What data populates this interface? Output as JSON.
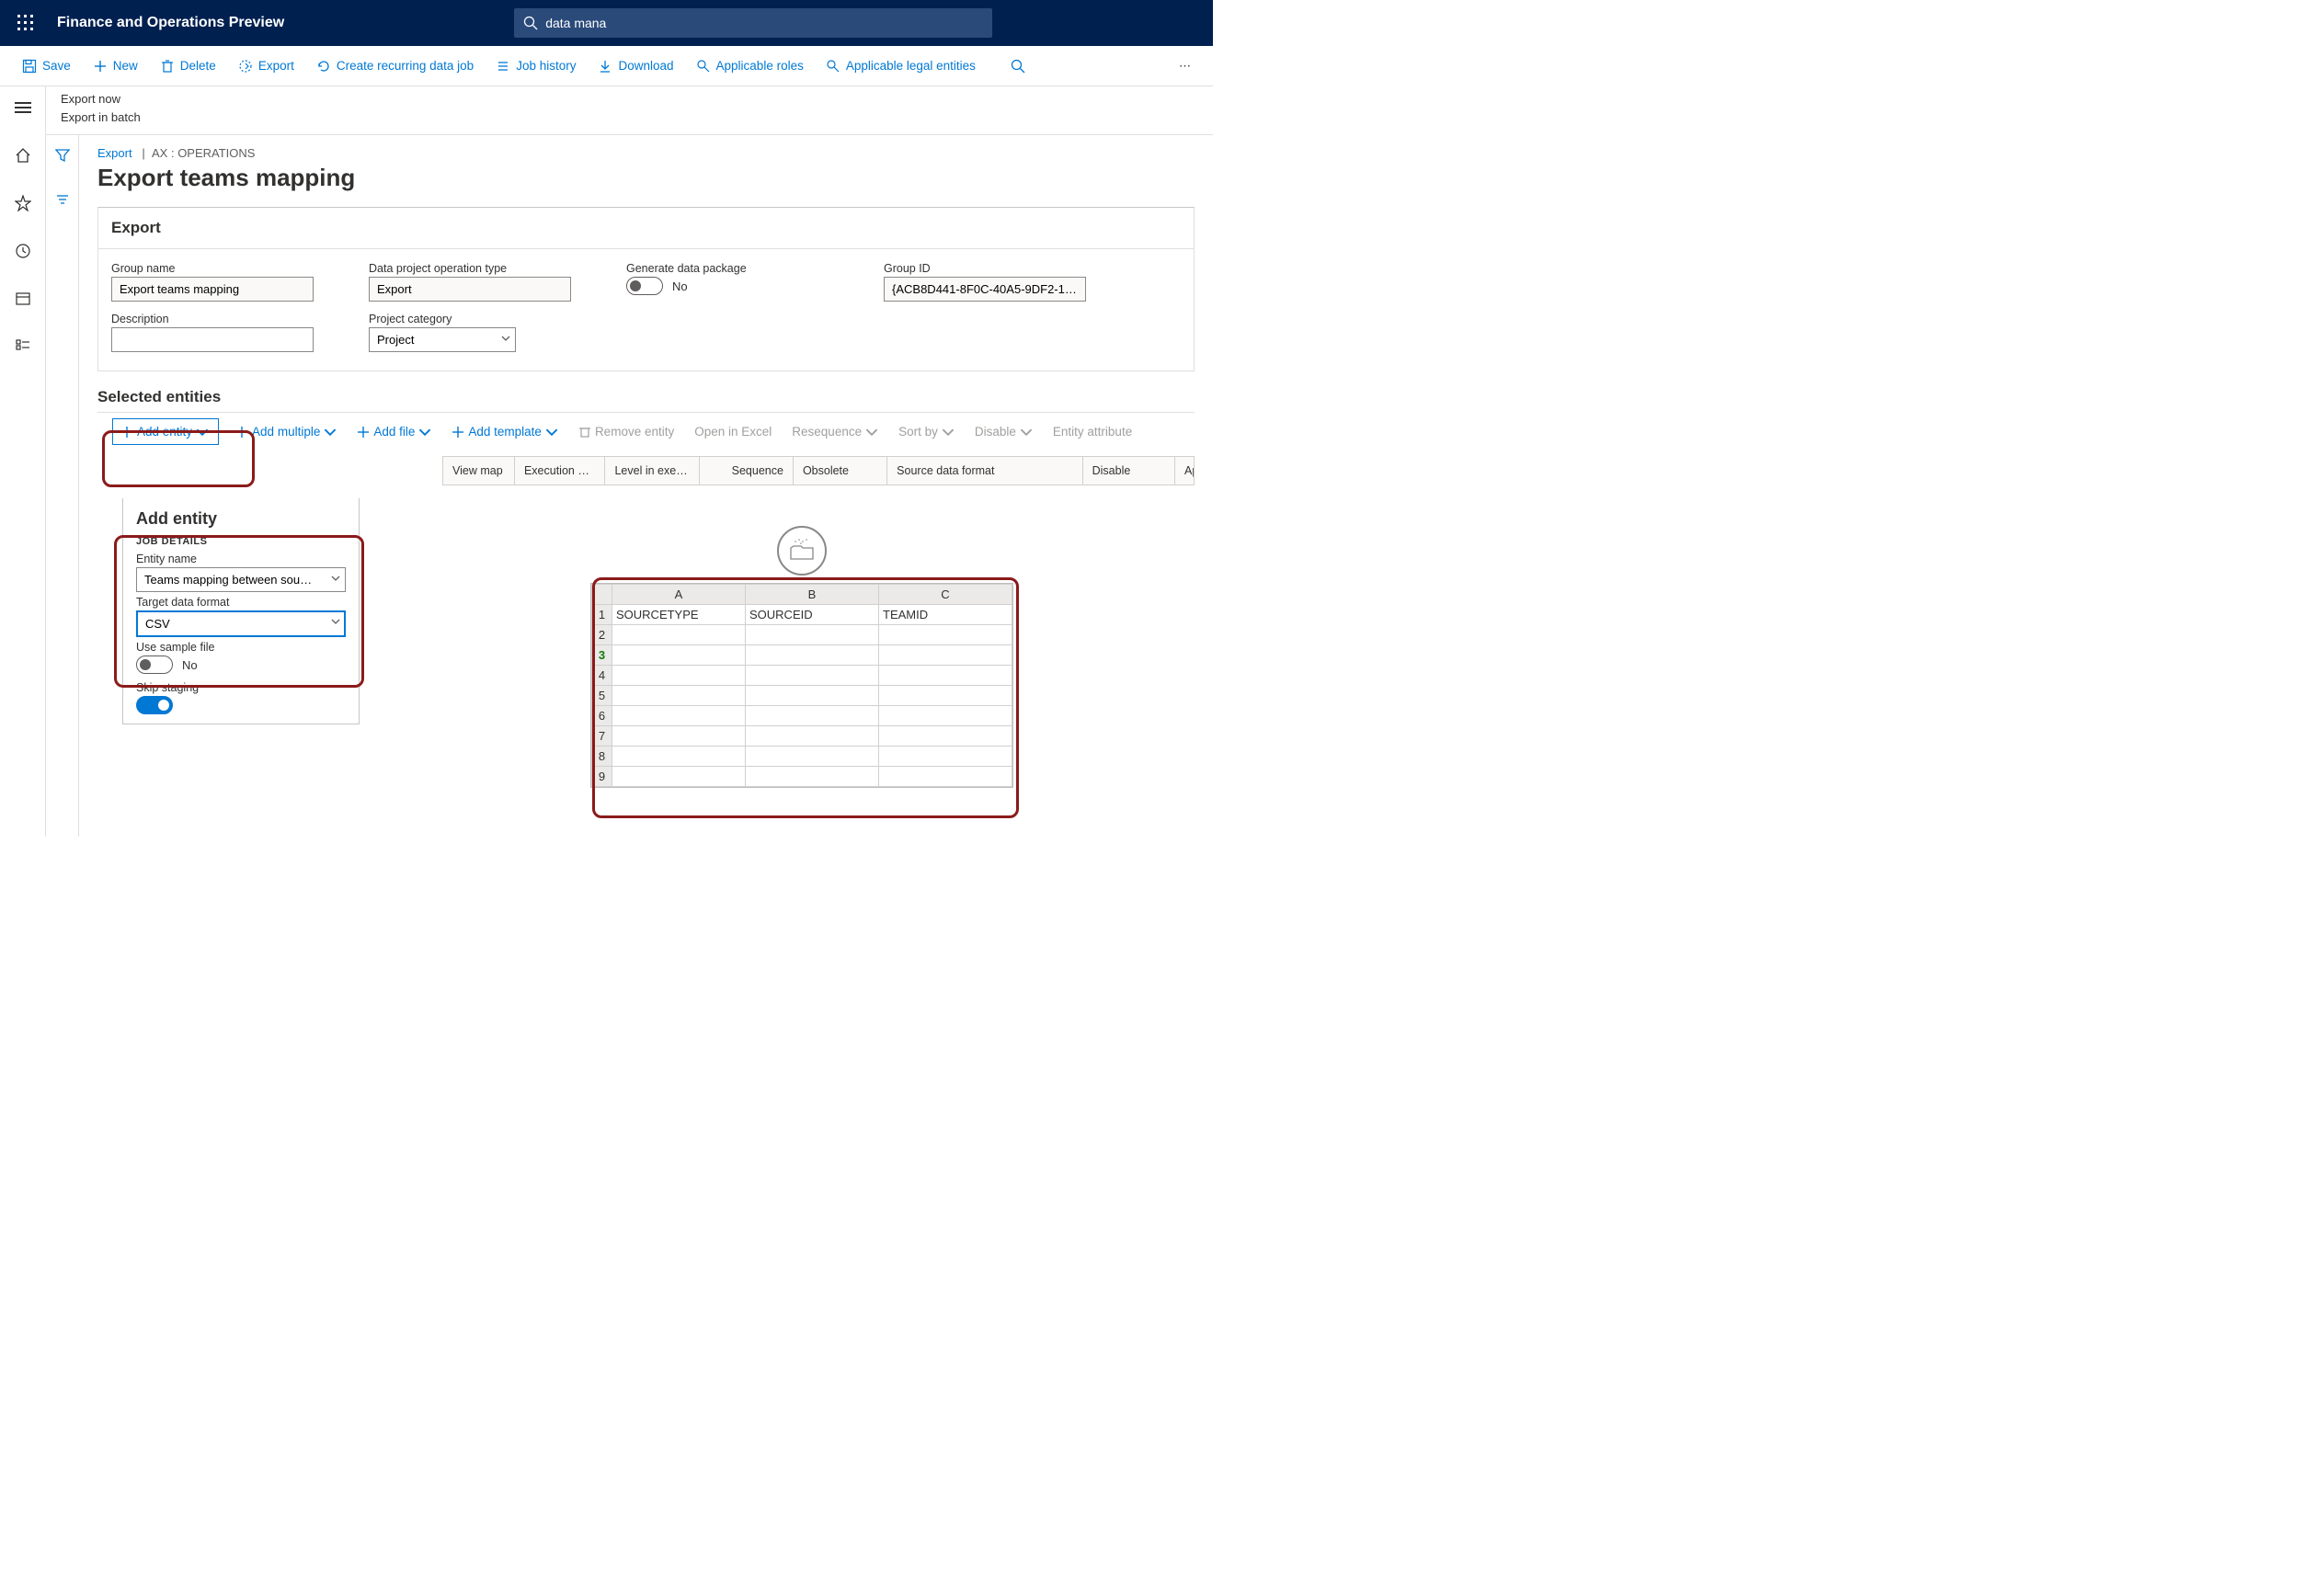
{
  "app_title": "Finance and Operations Preview",
  "search_value": "data mana",
  "commandbar": {
    "save": "Save",
    "new": "New",
    "delete": "Delete",
    "export": "Export",
    "recurring": "Create recurring data job",
    "job_history": "Job history",
    "download": "Download",
    "applicable_roles": "Applicable roles",
    "applicable_le": "Applicable legal entities"
  },
  "subactions": {
    "export_now": "Export now",
    "export_batch": "Export in batch"
  },
  "breadcrumb": {
    "link": "Export",
    "trail": "AX : OPERATIONS"
  },
  "page_title": "Export teams mapping",
  "export_panel": {
    "title": "Export",
    "group_name_label": "Group name",
    "group_name": "Export teams mapping",
    "op_type_label": "Data project operation type",
    "op_type": "Export",
    "gen_pkg_label": "Generate data package",
    "gen_pkg_value": "No",
    "desc_label": "Description",
    "desc": "",
    "proj_cat_label": "Project category",
    "proj_cat": "Project",
    "group_id_label": "Group ID",
    "group_id": "{ACB8D441-8F0C-40A5-9DF2-1…"
  },
  "entities": {
    "title": "Selected entities",
    "add_entity": "Add entity",
    "add_multiple": "Add multiple",
    "add_file": "Add file",
    "add_template": "Add template",
    "remove": "Remove entity",
    "open_excel": "Open in Excel",
    "resequence": "Resequence",
    "sort_by": "Sort by",
    "disable": "Disable",
    "entity_attr": "Entity attribute"
  },
  "grid_cols": {
    "view_map": "View map",
    "exec_unit": "Execution unit",
    "level": "Level in executi…",
    "sequence": "Sequence",
    "obsolete": "Obsolete",
    "src_fmt": "Source data format",
    "disable": "Disable",
    "applicat": "Applicat"
  },
  "flyout": {
    "title": "Add entity",
    "section": "JOB DETAILS",
    "entity_name_lbl": "Entity name",
    "entity_name": "Teams mapping between sou…",
    "target_fmt_lbl": "Target data format",
    "target_fmt": "CSV",
    "use_sample_lbl": "Use sample file",
    "use_sample_val": "No",
    "skip_staging_lbl": "Skip staging"
  },
  "sheet": {
    "cols": [
      "A",
      "B",
      "C"
    ],
    "headers": [
      "SOURCETYPE",
      "SOURCEID",
      "TEAMID"
    ],
    "rows": 9
  }
}
